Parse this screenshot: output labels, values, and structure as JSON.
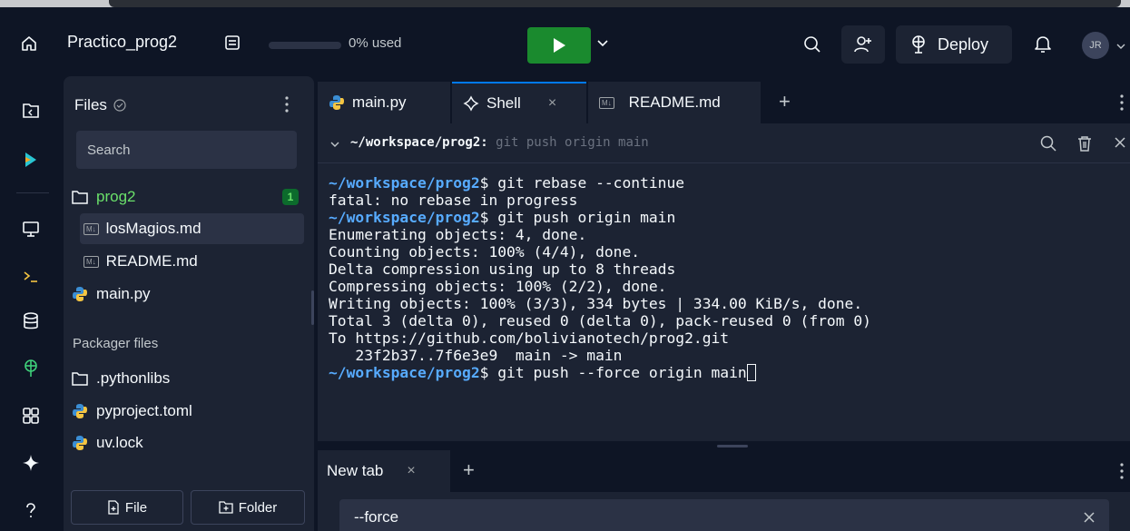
{
  "header": {
    "project_title": "Practico_prog2",
    "usage_text": "0% used",
    "usage_fraction": 0.0,
    "deploy_label": "Deploy",
    "avatar_initials": "JR"
  },
  "rail": {
    "icons": [
      "files-icon",
      "agent-icon",
      "preview-icon",
      "shell-icon",
      "database-icon",
      "deploy-icon",
      "all-tools-icon",
      "ai-icon",
      "help-icon"
    ]
  },
  "files": {
    "title": "Files",
    "search_placeholder": "Search",
    "tree": [
      {
        "label": "prog2",
        "type": "folder",
        "badge": "1"
      },
      {
        "label": "losMagios.md",
        "type": "md"
      },
      {
        "label": "README.md",
        "type": "md"
      },
      {
        "label": "main.py",
        "type": "py"
      }
    ],
    "packager_label": "Packager files",
    "packager_tree": [
      {
        "label": ".pythonlibs",
        "type": "folder"
      },
      {
        "label": "pyproject.toml",
        "type": "py"
      },
      {
        "label": "uv.lock",
        "type": "py"
      }
    ],
    "file_button": "File",
    "folder_button": "Folder"
  },
  "tabs": [
    {
      "label": "main.py",
      "icon": "python-icon"
    },
    {
      "label": "Shell",
      "icon": "shell-icon",
      "active": true
    },
    {
      "label": "README.md",
      "icon": "markdown-icon"
    }
  ],
  "shell": {
    "path": "~/workspace/prog2:",
    "last_command": "git push origin main",
    "lines": [
      {
        "prompt": "~/workspace/prog2",
        "text": "$ git rebase --continue"
      },
      {
        "prompt": "",
        "text": "fatal: no rebase in progress"
      },
      {
        "prompt": "~/workspace/prog2",
        "text": "$ git push origin main"
      },
      {
        "prompt": "",
        "text": "Enumerating objects: 4, done."
      },
      {
        "prompt": "",
        "text": "Counting objects: 100% (4/4), done."
      },
      {
        "prompt": "",
        "text": "Delta compression using up to 8 threads"
      },
      {
        "prompt": "",
        "text": "Compressing objects: 100% (2/2), done."
      },
      {
        "prompt": "",
        "text": "Writing objects: 100% (3/3), 334 bytes | 334.00 KiB/s, done."
      },
      {
        "prompt": "",
        "text": "Total 3 (delta 0), reused 0 (delta 0), pack-reused 0 (from 0)"
      },
      {
        "prompt": "",
        "text": "To https://github.com/bolivianotech/prog2.git"
      },
      {
        "prompt": "",
        "text": "   23f2b37..7f6e3e9  main -> main"
      },
      {
        "prompt": "~/workspace/prog2",
        "text": "$ git push --force origin main"
      }
    ]
  },
  "newtab": {
    "label": "New tab",
    "input_value": "--force"
  }
}
